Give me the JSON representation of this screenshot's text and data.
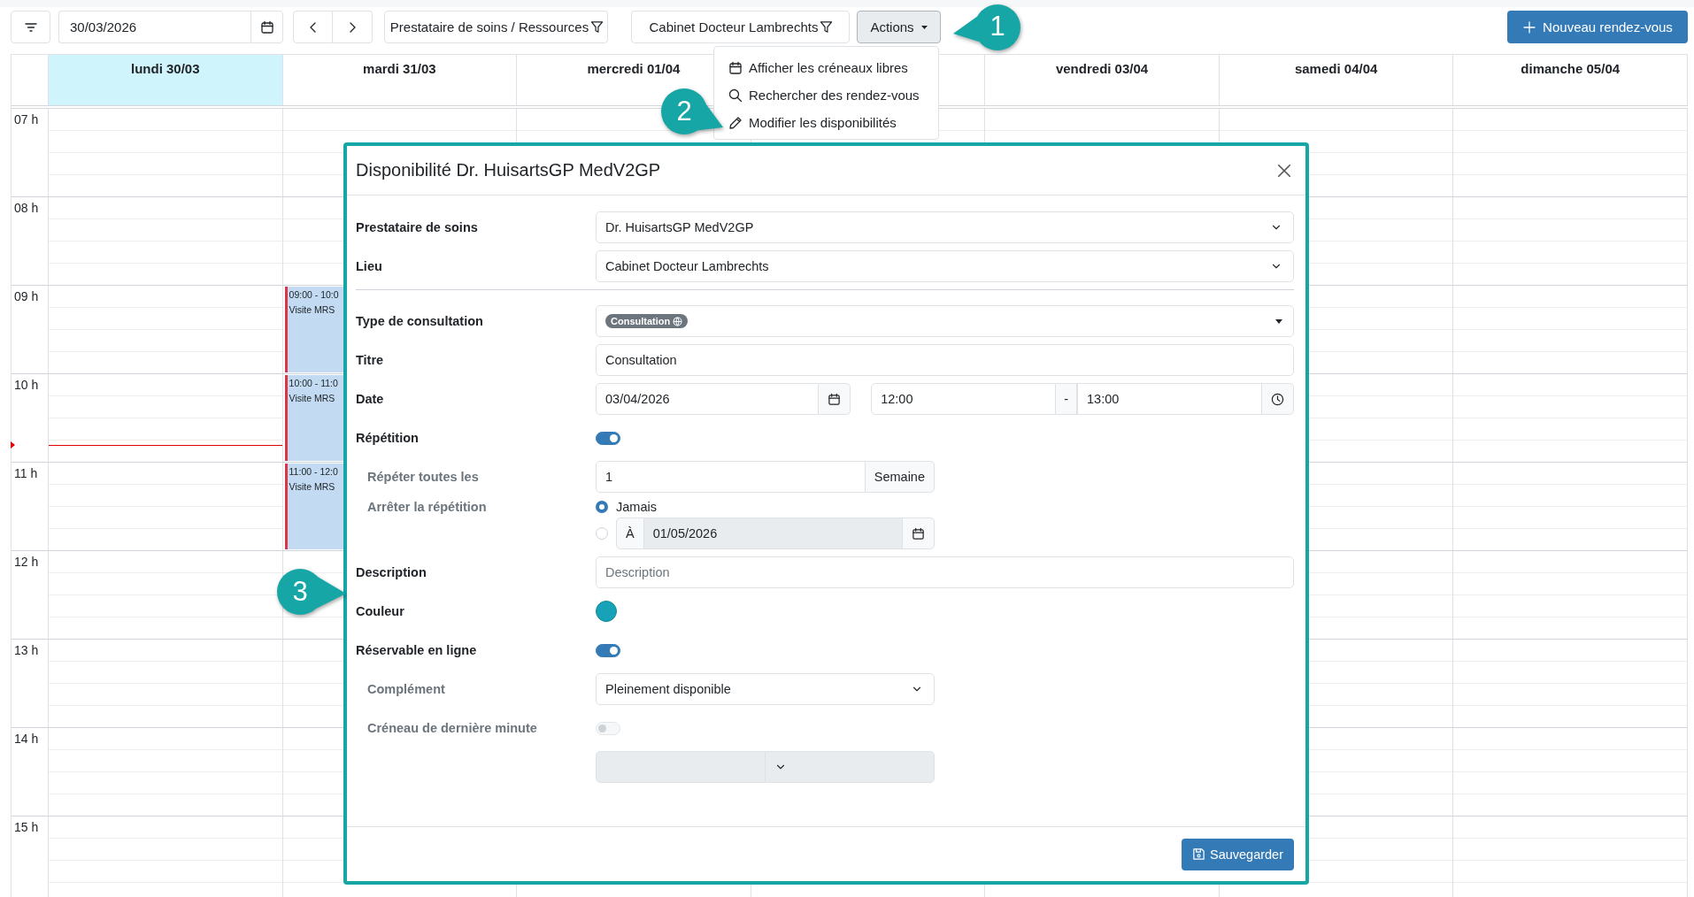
{
  "toolbar": {
    "date": "30/03/2026",
    "filters": [
      "Prestataire de soins / Ressources",
      "Cabinet Docteur Lambrechts"
    ],
    "actions_button": "Actions",
    "new_button": "Nouveau rendez-vous"
  },
  "actions_menu": {
    "expanded": true,
    "items": [
      {
        "label": "Afficher les créneaux libres"
      },
      {
        "label": "Rechercher des rendez-vous"
      },
      {
        "label": "Modifier les disponibilités"
      }
    ]
  },
  "calendar": {
    "days": [
      {
        "label": "lundi 30/03",
        "selected": true
      },
      {
        "label": "mardi 31/03",
        "selected": false,
        "appointments": [
          {
            "time": "09:00 - 10:0",
            "title": "Visite MRS"
          },
          {
            "time": "10:00 - 11:0",
            "title": "Visite MRS"
          },
          {
            "time": "11:00 - 12:0",
            "title": "Visite MRS"
          }
        ]
      },
      {
        "label": "mercredi 01/04",
        "selected": false
      },
      {
        "selected": false
      },
      {
        "label": "vendredi 03/04",
        "selected": false
      },
      {
        "label": "samedi 04/04",
        "selected": false
      },
      {
        "label": "dimanche 05/04",
        "selected": false
      }
    ],
    "hours": [
      "07 h",
      "08 h",
      "09 h",
      "10 h",
      "11 h",
      "12 h",
      "13 h",
      "14 h",
      "15 h"
    ]
  },
  "dialog": {
    "title": "Disponibilité Dr. HuisartsGP MedV2GP",
    "fields": [
      {
        "kind": "select",
        "label": "Prestataire de soins",
        "value": "Dr. HuisartsGP MedV2GP",
        "secondary": false
      },
      {
        "kind": "select",
        "label": "Lieu",
        "value": "Cabinet Docteur Lambrechts",
        "secondary": false
      },
      {
        "kind": "divider"
      },
      {
        "kind": "tag-select",
        "label": "Type de consultation",
        "tag": "Consultation",
        "secondary": false
      },
      {
        "kind": "text",
        "label": "Titre",
        "value": "Consultation",
        "secondary": false
      },
      {
        "kind": "datetime",
        "label": "Date",
        "date": "03/04/2026",
        "start": "12:00",
        "separator": "-",
        "end": "13:00",
        "secondary": false
      },
      {
        "kind": "toggle",
        "label": "Répétition",
        "on": true,
        "disabled": false,
        "secondary": false
      },
      {
        "kind": "number-unit",
        "label": "Répéter toutes les",
        "value": "1",
        "unit": "Semaine",
        "secondary": true
      },
      {
        "kind": "radio",
        "label": "Arrêter la répétition",
        "secondary": true,
        "options": [
          {
            "label": "Jamais",
            "selected": true
          },
          {
            "prefix": "À",
            "value": "01/05/2026",
            "selected": false,
            "disabled": true
          }
        ]
      },
      {
        "kind": "text",
        "label": "Description",
        "placeholder": "Description",
        "secondary": false
      },
      {
        "kind": "color",
        "label": "Couleur",
        "color": "#17a2b8",
        "secondary": false
      },
      {
        "kind": "toggle",
        "label": "Réservable en ligne",
        "on": true,
        "disabled": false,
        "secondary": false
      },
      {
        "kind": "select",
        "label": "Complément",
        "value": "Pleinement disponible",
        "secondary": true,
        "narrow": true
      },
      {
        "kind": "toggle",
        "label": "Créneau de dernière minute",
        "on": false,
        "disabled": true,
        "secondary": true
      },
      {
        "kind": "split-select",
        "disabled": true
      }
    ],
    "save_button": "Sauvegarder"
  },
  "callouts": [
    {
      "label": "1"
    },
    {
      "label": "2"
    },
    {
      "label": "3"
    }
  ]
}
